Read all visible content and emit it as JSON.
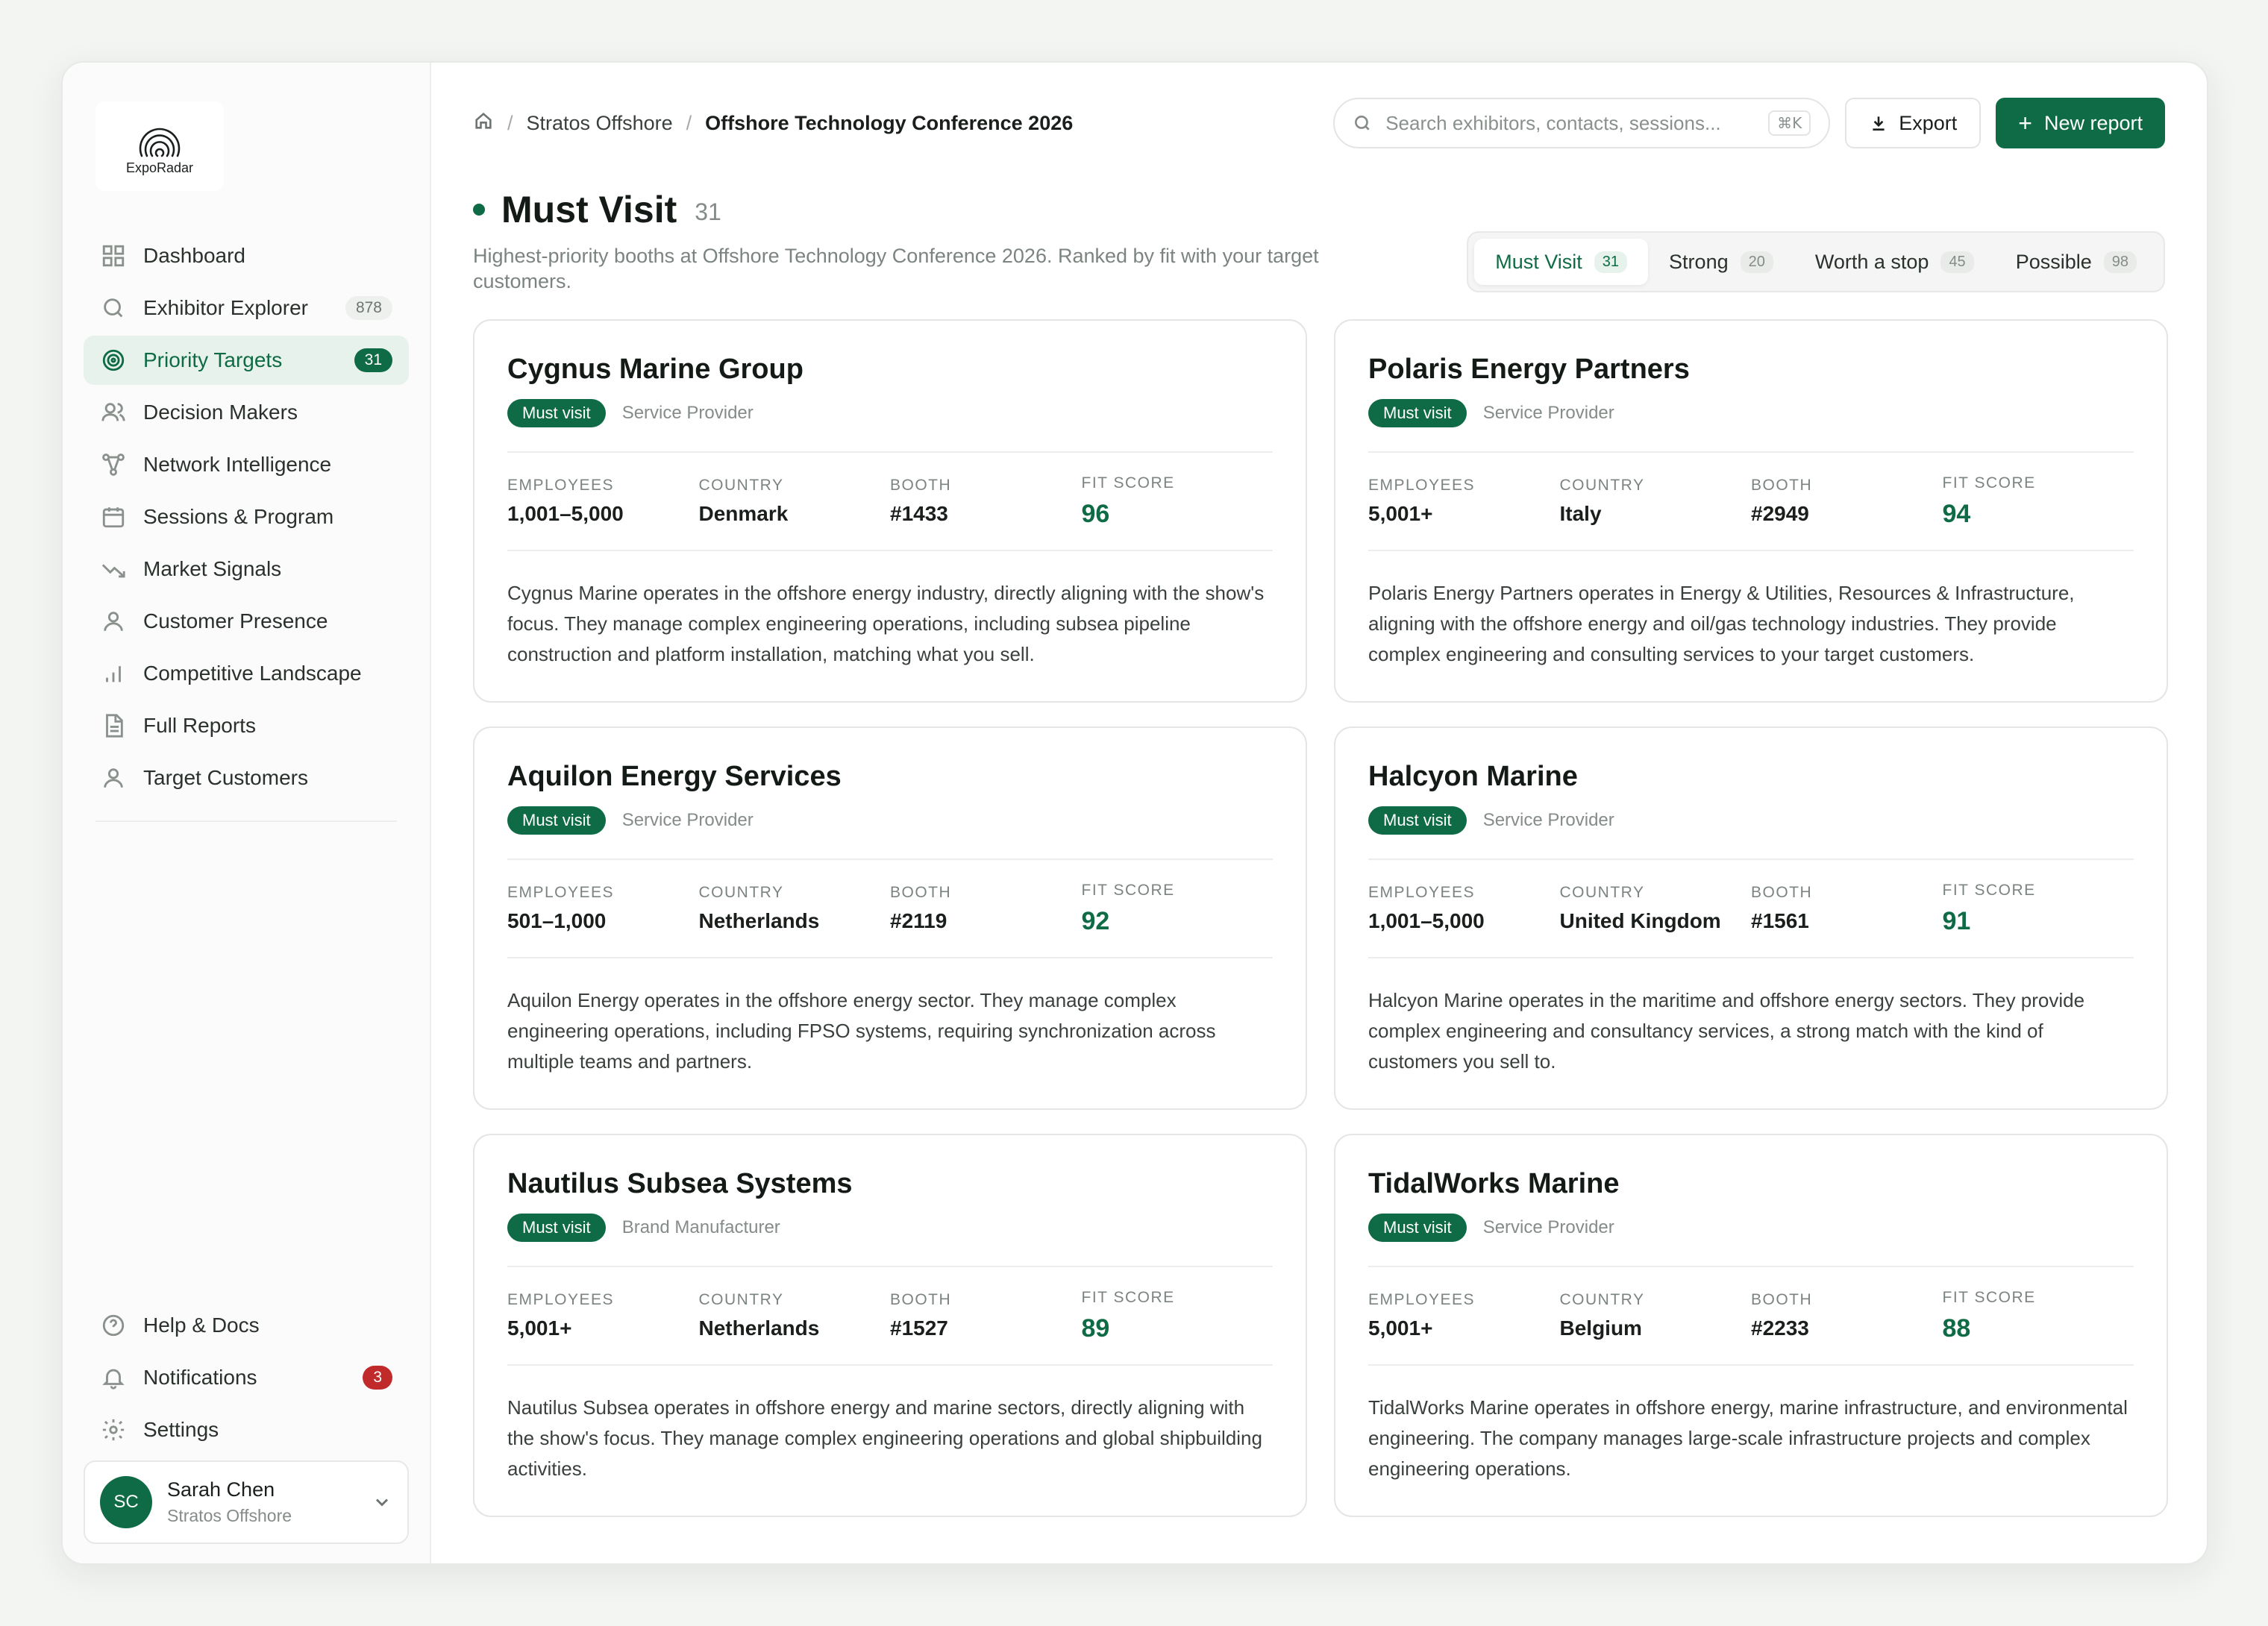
{
  "app": {
    "logo_text": "ExpoRadar"
  },
  "sidebar": {
    "items": [
      {
        "label": "Dashboard",
        "icon": "dashboard-icon",
        "count": ""
      },
      {
        "label": "Exhibitor Explorer",
        "icon": "search-icon",
        "count": "878"
      },
      {
        "label": "Priority Targets",
        "icon": "target-icon",
        "count": "31",
        "active": true
      },
      {
        "label": "Decision Makers",
        "icon": "users-icon",
        "count": ""
      },
      {
        "label": "Network Intelligence",
        "icon": "network-icon",
        "count": ""
      },
      {
        "label": "Sessions & Program",
        "icon": "calendar-icon",
        "count": ""
      },
      {
        "label": "Market Signals",
        "icon": "trend-icon",
        "count": ""
      },
      {
        "label": "Customer Presence",
        "icon": "user-icon",
        "count": ""
      },
      {
        "label": "Competitive Landscape",
        "icon": "bar-chart-icon",
        "count": ""
      },
      {
        "label": "Full Reports",
        "icon": "document-icon",
        "count": ""
      },
      {
        "label": "Target Customers",
        "icon": "person-icon",
        "count": ""
      }
    ],
    "bottom": [
      {
        "label": "Help & Docs",
        "icon": "help-icon",
        "count": ""
      },
      {
        "label": "Notifications",
        "icon": "bell-icon",
        "count": "3"
      },
      {
        "label": "Settings",
        "icon": "gear-icon",
        "count": ""
      }
    ],
    "user": {
      "initials": "SC",
      "name": "Sarah Chen",
      "org": "Stratos Offshore"
    }
  },
  "topbar": {
    "breadcrumb": [
      "Stratos Offshore",
      "Offshore Technology Conference 2026"
    ],
    "search_placeholder": "Search exhibitors, contacts, sessions...",
    "search_shortcut": "⌘K",
    "export_label": "Export",
    "new_report_label": "New report"
  },
  "page": {
    "title": "Must Visit",
    "count": "31",
    "subtitle": "Highest-priority booths at Offshore Technology Conference 2026. Ranked by fit with your target customers."
  },
  "segments": [
    {
      "label": "Must Visit",
      "count": "31",
      "active": true
    },
    {
      "label": "Strong",
      "count": "20"
    },
    {
      "label": "Worth a stop",
      "count": "45"
    },
    {
      "label": "Possible",
      "count": "98"
    }
  ],
  "stat_labels": {
    "employees": "EMPLOYEES",
    "country": "COUNTRY",
    "booth": "BOOTH",
    "fit": "FIT SCORE"
  },
  "cards": [
    {
      "name": "Cygnus Marine Group",
      "tag": "Must visit",
      "type": "Service Provider",
      "employees": "1,001–5,000",
      "country": "Denmark",
      "booth": "#1433",
      "fit": "96",
      "description": "Cygnus Marine operates in the offshore energy industry, directly aligning with the show's focus. They manage complex engineering operations, including subsea pipeline construction and platform installation, matching what you sell."
    },
    {
      "name": "Polaris Energy Partners",
      "tag": "Must visit",
      "type": "Service Provider",
      "employees": "5,001+",
      "country": "Italy",
      "booth": "#2949",
      "fit": "94",
      "description": "Polaris Energy Partners operates in Energy & Utilities, Resources & Infrastructure, aligning with the offshore energy and oil/gas technology industries. They provide complex engineering and consulting services to your target customers."
    },
    {
      "name": "Aquilon Energy Services",
      "tag": "Must visit",
      "type": "Service Provider",
      "employees": "501–1,000",
      "country": "Netherlands",
      "booth": "#2119",
      "fit": "92",
      "description": "Aquilon Energy operates in the offshore energy sector. They manage complex engineering operations, including FPSO systems, requiring synchronization across multiple teams and partners."
    },
    {
      "name": "Halcyon Marine",
      "tag": "Must visit",
      "type": "Service Provider",
      "employees": "1,001–5,000",
      "country": "United Kingdom",
      "booth": "#1561",
      "fit": "91",
      "description": "Halcyon Marine operates in the maritime and offshore energy sectors. They provide complex engineering and consultancy services, a strong match with the kind of customers you sell to."
    },
    {
      "name": "Nautilus Subsea Systems",
      "tag": "Must visit",
      "type": "Brand Manufacturer",
      "employees": "5,001+",
      "country": "Netherlands",
      "booth": "#1527",
      "fit": "89",
      "description": "Nautilus Subsea operates in offshore energy and marine sectors, directly aligning with the show's focus. They manage complex engineering operations and global shipbuilding activities."
    },
    {
      "name": "TidalWorks Marine",
      "tag": "Must visit",
      "type": "Service Provider",
      "employees": "5,001+",
      "country": "Belgium",
      "booth": "#2233",
      "fit": "88",
      "description": "TidalWorks Marine operates in offshore energy, marine infrastructure, and environmental engineering. The company manages large-scale infrastructure projects and complex engineering operations."
    }
  ]
}
